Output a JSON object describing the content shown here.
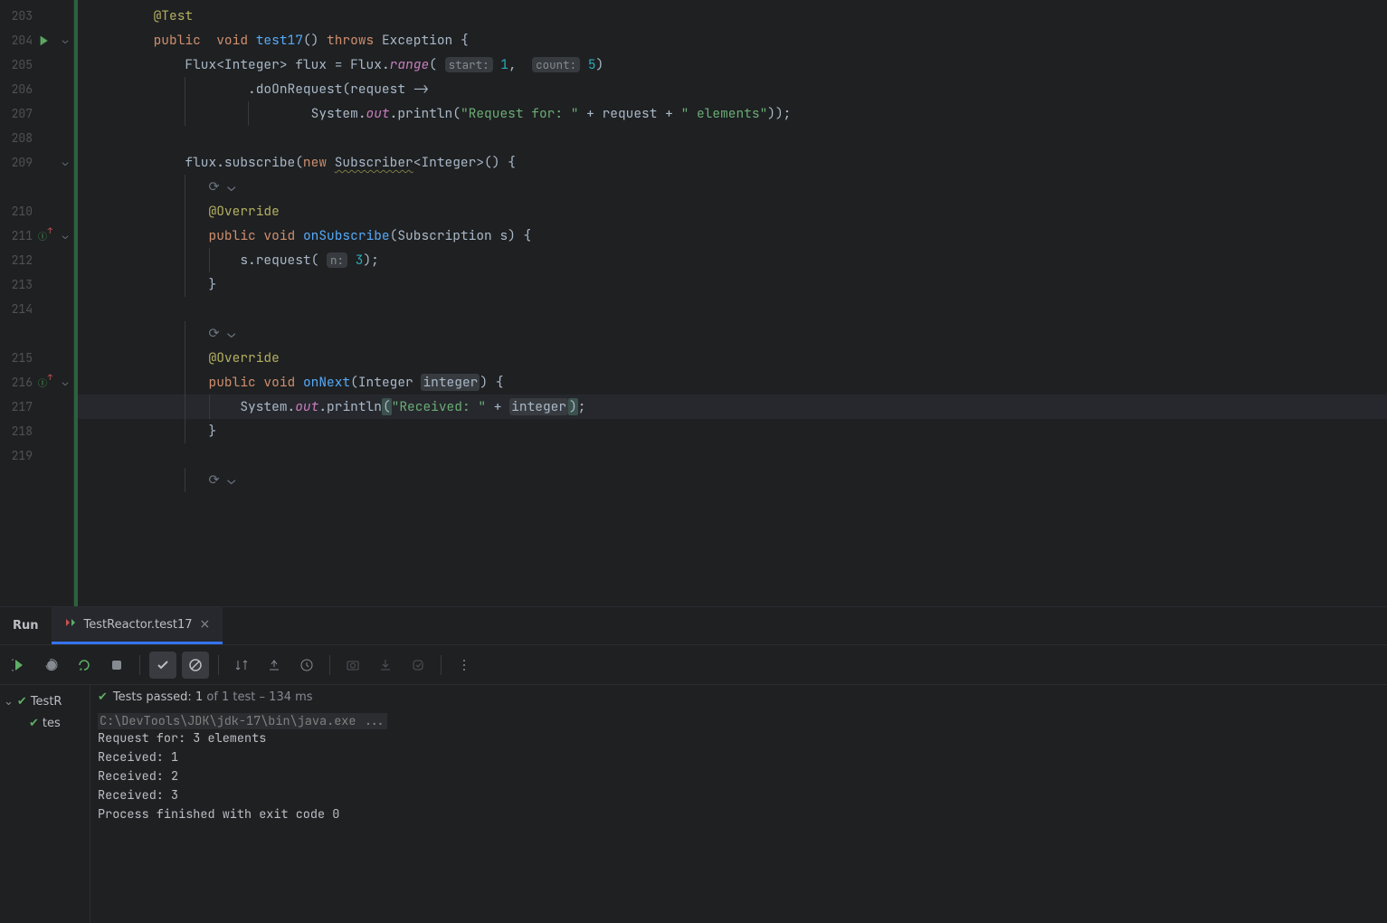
{
  "editor": {
    "lines": [
      {
        "n": "203",
        "fold": "",
        "icon": ""
      },
      {
        "n": "204",
        "fold": "v",
        "icon": "run"
      },
      {
        "n": "205",
        "fold": "",
        "icon": ""
      },
      {
        "n": "206",
        "fold": "",
        "icon": ""
      },
      {
        "n": "207",
        "fold": "",
        "icon": ""
      },
      {
        "n": "208",
        "fold": "",
        "icon": ""
      },
      {
        "n": "209",
        "fold": "v",
        "icon": ""
      },
      {
        "n": "",
        "fold": "",
        "icon": ""
      },
      {
        "n": "210",
        "fold": "",
        "icon": ""
      },
      {
        "n": "211",
        "fold": "v",
        "icon": "ovr"
      },
      {
        "n": "212",
        "fold": "",
        "icon": ""
      },
      {
        "n": "213",
        "fold": "",
        "icon": ""
      },
      {
        "n": "214",
        "fold": "",
        "icon": ""
      },
      {
        "n": "",
        "fold": "",
        "icon": ""
      },
      {
        "n": "215",
        "fold": "",
        "icon": ""
      },
      {
        "n": "216",
        "fold": "v",
        "icon": "ovr"
      },
      {
        "n": "217",
        "fold": "",
        "icon": "bulb"
      },
      {
        "n": "218",
        "fold": "",
        "icon": ""
      },
      {
        "n": "219",
        "fold": "",
        "icon": ""
      },
      {
        "n": "",
        "fold": "",
        "icon": ""
      }
    ],
    "tokens": {
      "test_ann": "@Test",
      "public": "public",
      "void": "void",
      "test17": "test17",
      "throws": "throws",
      "exception": "Exception",
      "flux_t": "Flux",
      "integer": "Integer",
      "flux_var": "flux",
      "eq": "=",
      "range": "range",
      "start_h": "start:",
      "start_v": "1",
      "count_h": "count:",
      "count_v": "5",
      "doOnRequest": ".doOnRequest",
      "request": "request",
      "arrow": "->",
      "system": "System",
      "out": "out",
      "println": ".println",
      "req_str": "\"Request for: \"",
      "plus": "+",
      "elem_str": "\" elements\"",
      "subscribe": ".subscribe",
      "new": "new",
      "subscriber": "Subscriber",
      "override": "@Override",
      "onSubscribe": "onSubscribe",
      "subscription": "Subscription",
      "s_param": "s",
      "s_req": "s.request",
      "n_h": "n:",
      "n_v": "3",
      "onNext": "onNext",
      "integer_p": "integer",
      "recv_str": "\"Received: \""
    }
  },
  "run": {
    "label": "Run",
    "tab": "TestReactor.test17",
    "status_prefix": "Tests passed: ",
    "passed": "1",
    "status_mid": " of 1 test",
    "status_time": " – 134 ms",
    "tree_root": "TestR",
    "tree_leaf": "tes",
    "cmd": "C:\\DevTools\\JDK\\jdk-17\\bin\\java.exe ...",
    "out1": "Request for: 3 elements",
    "out2": "Received: 1",
    "out3": "Received: 2",
    "out4": "Received: 3",
    "out5": "",
    "out6": "Process finished with exit code 0"
  }
}
